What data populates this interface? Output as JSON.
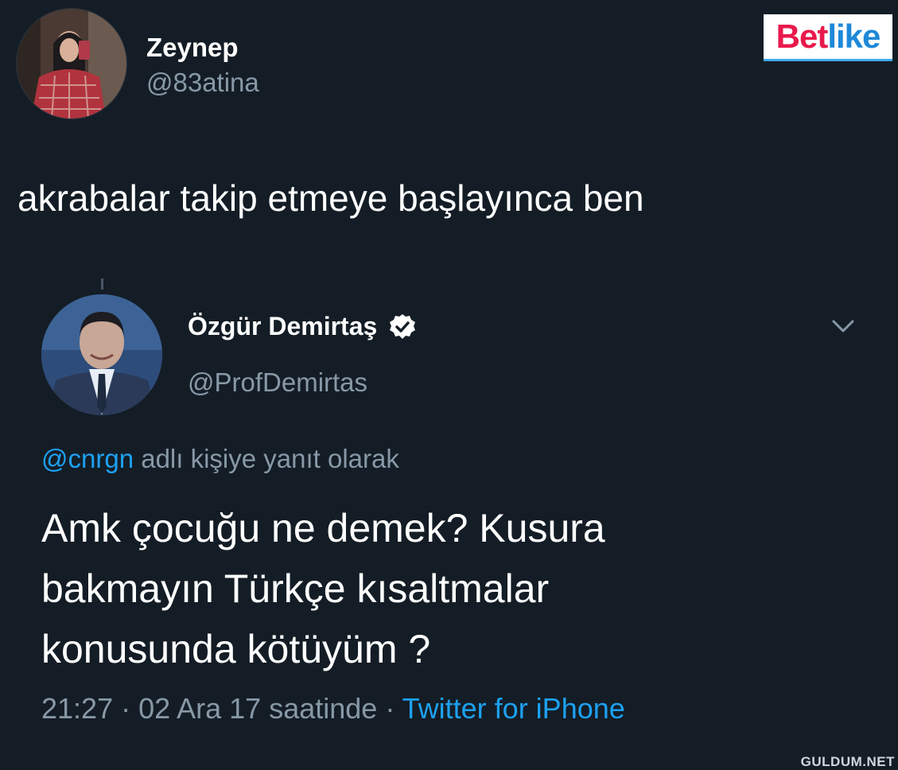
{
  "logo": {
    "part1": "Bet",
    "part2": "like"
  },
  "tweet": {
    "author_name": "Zeynep",
    "author_handle": "@83atina",
    "text": "akrabalar takip etmeye başlayınca ben"
  },
  "quoted_tweet": {
    "author_name": "Özgür Demirtaş",
    "author_handle": "@ProfDemirtas",
    "reply_mention": "@cnrgn",
    "reply_suffix": " adlı kişiye yanıt olarak",
    "body_lines": [
      "Amk çocuğu ne demek? Kusura",
      "bakmayın Türkçe kısaltmalar",
      "konusunda kötüyüm ?"
    ],
    "timestamp": "21:27 · 02 Ara 17 saatinde · ",
    "source": "Twitter for iPhone"
  },
  "watermark": "GULDUM.NET",
  "colors": {
    "background": "#141d26",
    "secondary_text": "#8899a6",
    "link": "#1da1f2"
  }
}
